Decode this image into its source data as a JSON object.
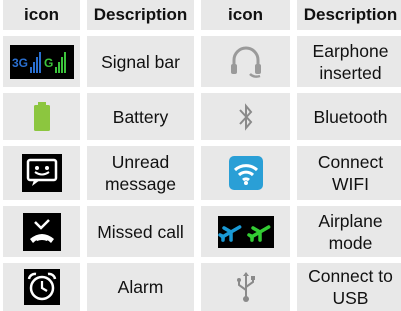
{
  "headers": {
    "icon_left": "icon",
    "description_left": "Description",
    "icon_right": "icon",
    "description_right": "Description"
  },
  "rows": [
    {
      "left_icon": "signal-bar-icon",
      "left_icon_text": "3G G",
      "left_desc": "Signal bar",
      "right_icon": "earphone-icon",
      "right_desc": "Earphone\ninserted"
    },
    {
      "left_icon": "battery-icon",
      "left_desc": "Battery",
      "right_icon": "bluetooth-icon",
      "right_desc": "Bluetooth"
    },
    {
      "left_icon": "unread-message-icon",
      "left_desc": "Unread\nmessage",
      "right_icon": "wifi-icon",
      "right_desc": "Connect\nWIFI"
    },
    {
      "left_icon": "missed-call-icon",
      "left_desc": "Missed call",
      "right_icon": "airplane-icon",
      "right_desc": "Airplane\nmode"
    },
    {
      "left_icon": "alarm-icon",
      "left_desc": "Alarm",
      "right_icon": "usb-icon",
      "right_desc": "Connect to\nUSB"
    }
  ],
  "colors": {
    "cell_bg": "#e8e8e8",
    "signal_blue": "#2a6fd0",
    "signal_green": "#3cc33c",
    "battery_green": "#8cc63f",
    "wifi_blue": "#2a9fd6",
    "airplane_teal": "#1a9ad6",
    "airplane_green": "#33cc33"
  }
}
